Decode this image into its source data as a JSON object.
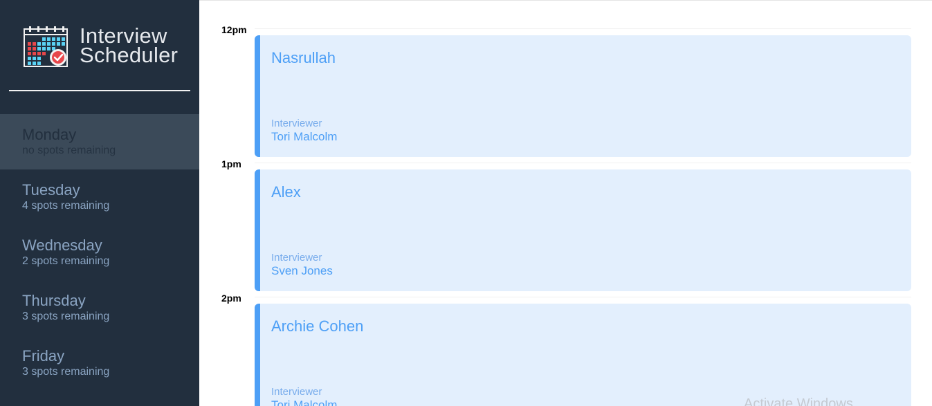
{
  "brand": {
    "line1": "Interview",
    "line2": "Scheduler"
  },
  "days": [
    {
      "name": "Monday",
      "spots": "no spots remaining",
      "selected": true
    },
    {
      "name": "Tuesday",
      "spots": "4 spots remaining"
    },
    {
      "name": "Wednesday",
      "spots": "2 spots remaining"
    },
    {
      "name": "Thursday",
      "spots": "3 spots remaining"
    },
    {
      "name": "Friday",
      "spots": "3 spots remaining"
    }
  ],
  "appointments": [
    {
      "time": "12pm",
      "student": "Nasrullah",
      "interviewer_label": "Interviewer",
      "interviewer": "Tori Malcolm"
    },
    {
      "time": "1pm",
      "student": "Alex",
      "interviewer_label": "Interviewer",
      "interviewer": "Sven Jones"
    },
    {
      "time": "2pm",
      "student": "Archie Cohen",
      "interviewer_label": "Interviewer",
      "interviewer": "Tori Malcolm"
    }
  ],
  "watermark": "Activate Windows",
  "colors": {
    "sidebar": "#222f3e",
    "selected_day": "#3b4a59",
    "appointment_bg": "#e3effd",
    "accent": "#4d9ff6",
    "logo_red": "#e8474b",
    "logo_cyan": "#5ad2f4"
  },
  "icons": {
    "logo": "calendar-check-icon"
  }
}
